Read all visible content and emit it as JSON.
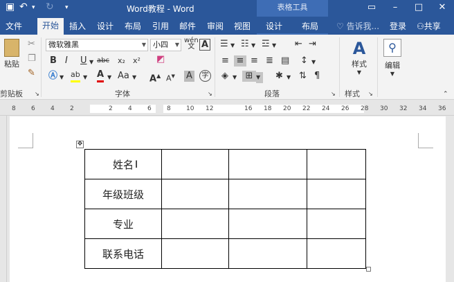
{
  "app": {
    "doc_title": "Word教程 - Word",
    "context_tab_group": "表格工具"
  },
  "tabs": {
    "file": "文件",
    "home": "开始",
    "insert": "插入",
    "design": "设计",
    "layout": "布局",
    "references": "引用",
    "mailings": "邮件",
    "review": "审阅",
    "view": "视图",
    "table_design": "设计",
    "table_layout": "布局",
    "tell_me": "告诉我...",
    "signin": "登录",
    "share": "共享"
  },
  "ribbon": {
    "paste_label": "粘贴",
    "clipboard_label": "剪贴板",
    "font_name": "微软雅黑",
    "font_size": "小四",
    "font_group_label": "字体",
    "paragraph_group_label": "段落",
    "styles_label": "样式",
    "styles_group_label": "样式",
    "editing_label": "编辑",
    "wen_glyph": "wén",
    "wen_char": "文",
    "a_char": "A",
    "bold": "B",
    "italic": "I",
    "underline": "U",
    "strike": "abc",
    "subscript": "x₂",
    "superscript": "x²",
    "aa": "Aa",
    "zi": "字"
  },
  "ruler_numbers": [
    "8",
    "6",
    "4",
    "2",
    "2",
    "4",
    "6",
    "8",
    "10",
    "12",
    "16",
    "18",
    "20",
    "22",
    "24",
    "26",
    "28",
    "30",
    "32",
    "34",
    "36"
  ],
  "table": {
    "rows": [
      [
        "姓名",
        "",
        "",
        ""
      ],
      [
        "年级班级",
        "",
        "",
        ""
      ],
      [
        "专业",
        "",
        "",
        ""
      ],
      [
        "联系电话",
        "",
        "",
        ""
      ]
    ]
  },
  "colors": {
    "accent": "#2b579a",
    "context_tab": "#3e6db5",
    "ribbon_bg": "#f3f3f3",
    "highlight_yellow": "#ffff00",
    "font_red": "#e00000"
  }
}
